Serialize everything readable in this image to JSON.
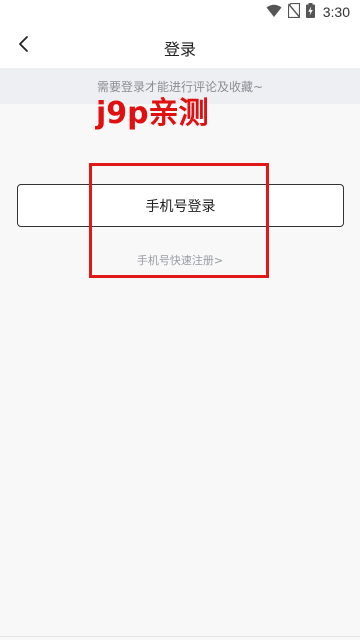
{
  "status_bar": {
    "time": "3:30",
    "icons": [
      "wifi-icon",
      "sim-off-icon",
      "battery-charging-icon"
    ]
  },
  "header": {
    "back_icon": "chevron-left-icon",
    "title": "登录"
  },
  "notice": {
    "text": "需要登录才能进行评论及收藏~"
  },
  "watermark": {
    "text": "j9p亲测"
  },
  "login": {
    "phone_login_label": "手机号登录",
    "quick_register_label": "手机号快速注册>"
  },
  "colors": {
    "accent_red": "#e01818",
    "notice_bg": "#eeeff2",
    "page_bg": "#f8f8f9"
  }
}
